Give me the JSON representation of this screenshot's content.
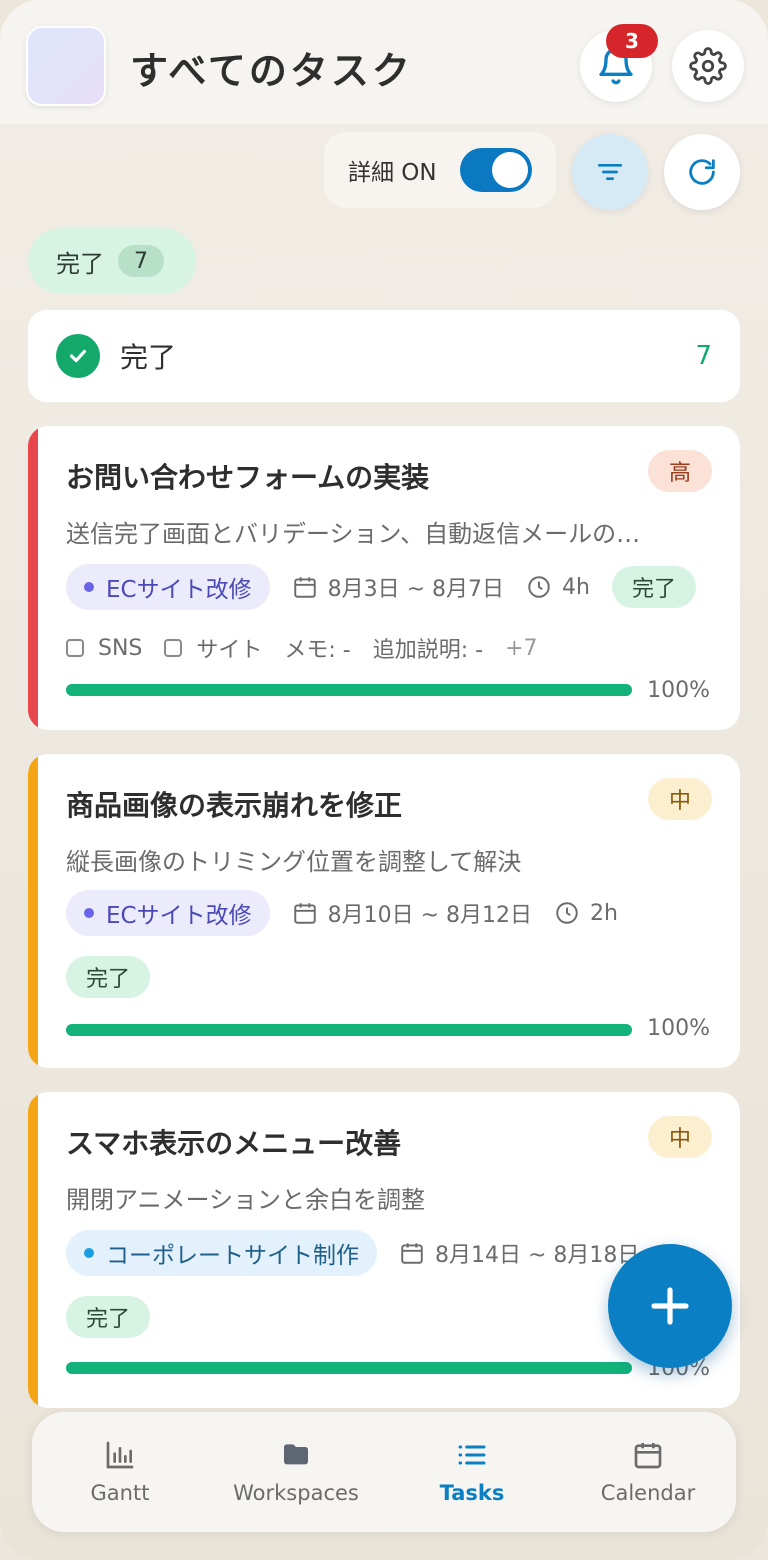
{
  "header": {
    "title": "すべてのタスク",
    "notification_count": "3",
    "icons": {
      "bell": "bell-icon",
      "settings": "gear-icon"
    }
  },
  "toolbar": {
    "detail_label": "詳細 ON",
    "detail_on": true
  },
  "summary_pill": {
    "label": "完了",
    "count": "7"
  },
  "group": {
    "title": "完了",
    "count": "7"
  },
  "tasks": [
    {
      "title": "お問い合わせフォームの実装",
      "priority": "高",
      "description": "送信完了画面とバリデーション、自動返信メールの…",
      "project": "ECサイト改修",
      "dates": "8月3日 ~ 8月7日",
      "duration": "4h",
      "status": "完了",
      "checklist": [
        "SNS",
        "サイト"
      ],
      "memo": "メモ: -",
      "extra_note": "追加説明: -",
      "more": "+7",
      "progress_label": "100%",
      "progress": 100
    },
    {
      "title": "商品画像の表示崩れを修正",
      "priority": "中",
      "description": "縦長画像のトリミング位置を調整して解決",
      "project": "ECサイト改修",
      "dates": "8月10日 ~ 8月12日",
      "duration": "2h",
      "status": "完了",
      "progress_label": "100%",
      "progress": 100
    },
    {
      "title": "スマホ表示のメニュー改善",
      "priority": "中",
      "description": "開閉アニメーションと余白を調整",
      "project": "コーポレートサイト制作",
      "dates": "8月14日 ~ 8月18日",
      "status": "完了",
      "progress_label": "100%",
      "progress": 100
    }
  ],
  "nav": {
    "items": [
      {
        "label": "Gantt",
        "icon": "gantt-chart-icon"
      },
      {
        "label": "Workspaces",
        "icon": "folder-icon"
      },
      {
        "label": "Tasks",
        "icon": "list-icon",
        "active": true
      },
      {
        "label": "Calendar",
        "icon": "calendar-icon"
      }
    ]
  },
  "colors": {
    "accent": "#0a7fc4",
    "high_priority": "#e8474b",
    "mid_priority": "#f4a516",
    "done": "#13b27a"
  }
}
